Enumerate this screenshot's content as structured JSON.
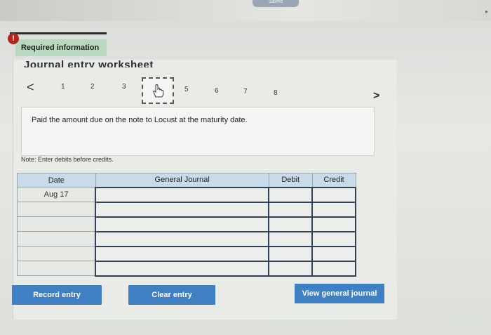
{
  "status": {
    "saved_label": "Saved"
  },
  "alert": {
    "icon": "alert-icon",
    "symbol": "!"
  },
  "required_tab": {
    "label": "Required information"
  },
  "worksheet": {
    "title": "Journal entry worksheet",
    "pager": {
      "prev_symbol": "<",
      "next_symbol": ">",
      "pages": [
        "1",
        "2",
        "3",
        "4",
        "5",
        "6",
        "7",
        "8"
      ],
      "active_page": "4"
    },
    "description": "Paid the amount due on the note to Locust at the maturity date.",
    "note": "Note: Enter debits before credits."
  },
  "journal": {
    "headers": {
      "date": "Date",
      "general_journal": "General Journal",
      "debit": "Debit",
      "credit": "Credit"
    },
    "rows": [
      {
        "date": "Aug 17",
        "account": "",
        "debit": "",
        "credit": ""
      },
      {
        "date": "",
        "account": "",
        "debit": "",
        "credit": ""
      },
      {
        "date": "",
        "account": "",
        "debit": "",
        "credit": ""
      },
      {
        "date": "",
        "account": "",
        "debit": "",
        "credit": ""
      },
      {
        "date": "",
        "account": "",
        "debit": "",
        "credit": ""
      },
      {
        "date": "",
        "account": "",
        "debit": "",
        "credit": ""
      }
    ]
  },
  "buttons": {
    "record": "Record entry",
    "clear": "Clear entry",
    "view": "View general journal"
  },
  "colors": {
    "button_blue": "#3f7fc4",
    "tab_green": "#b8d8bf",
    "header_blue": "#c9dbe8",
    "alert_red": "#b3261e"
  }
}
